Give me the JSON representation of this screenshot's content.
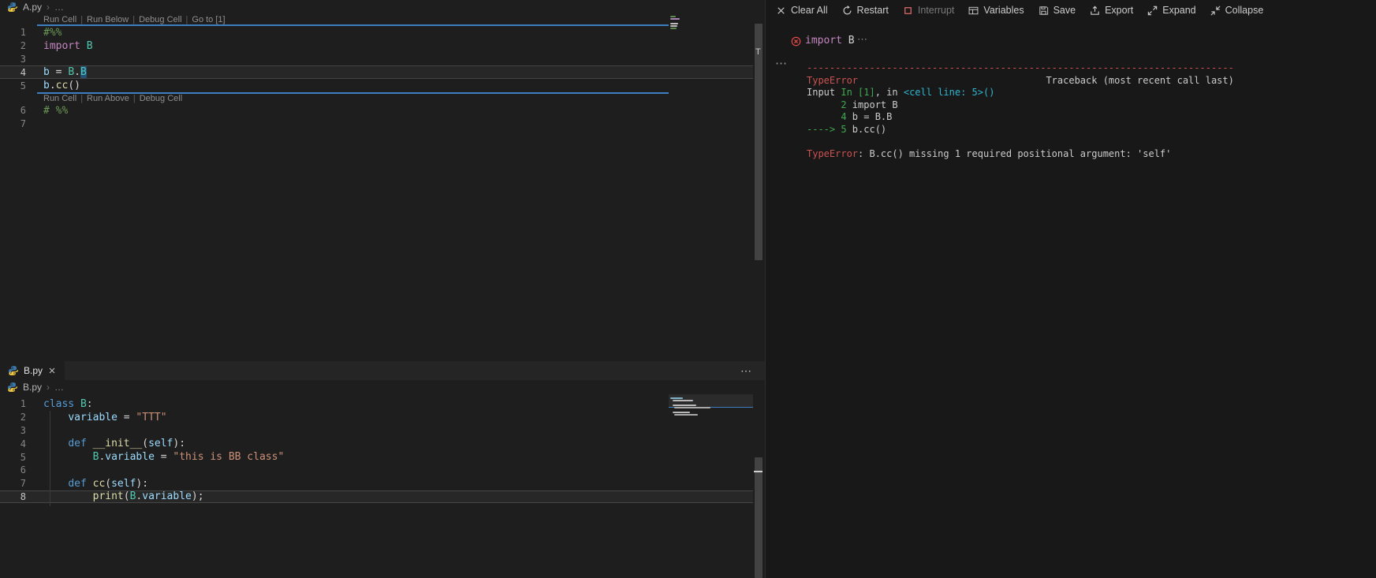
{
  "palette": {
    "comment": "#6A9955",
    "keyword": "#C586C0",
    "storage": "#569CD6",
    "cls": "#4EC9B0",
    "func": "#DCDCAA",
    "var": "#9CDCFE",
    "string": "#CE9178",
    "plain": "#D4D4D4",
    "red": "#CD5252",
    "green": "#3FA94F",
    "cyan": "#2FB4CE",
    "fg": "#CCCCCC",
    "dim": "#8A8A8A"
  },
  "breadcrumb_a": {
    "file": "A.py",
    "sep": "›",
    "more": "…"
  },
  "breadcrumb_b": {
    "file": "B.py",
    "sep": "›",
    "more": "…"
  },
  "editor_a": {
    "codelens1": [
      "Run Cell",
      "Run Below",
      "Debug Cell",
      "Go to [1]"
    ],
    "codelens2": [
      "Run Cell",
      "Run Above",
      "Debug Cell"
    ],
    "cell1_rows": [
      {
        "n": "1",
        "tokens": [
          [
            "#%%",
            "comment"
          ]
        ]
      },
      {
        "n": "2",
        "tokens": [
          [
            "import",
            "keyword"
          ],
          [
            " ",
            "plain"
          ],
          [
            "B",
            "cls"
          ]
        ]
      },
      {
        "n": "3",
        "tokens": []
      },
      {
        "n": "4",
        "active": true,
        "tokens": [
          [
            "b",
            "var"
          ],
          [
            " = ",
            "plain"
          ],
          [
            "B",
            "cls"
          ],
          [
            ".",
            "plain"
          ],
          [
            "B",
            "cls",
            "hl"
          ]
        ]
      },
      {
        "n": "5",
        "tokens": [
          [
            "b",
            "var"
          ],
          [
            ".",
            "plain"
          ],
          [
            "cc",
            "func"
          ],
          [
            "()",
            "plain"
          ]
        ]
      }
    ],
    "cell2_rows": [
      {
        "n": "6",
        "tokens": [
          [
            "# %%",
            "comment"
          ]
        ]
      },
      {
        "n": "7",
        "tokens": []
      }
    ],
    "scroll_mark": "T"
  },
  "tabbar": {
    "tab": "B.py",
    "more": "⋯"
  },
  "editor_b": {
    "rows": [
      {
        "n": "1",
        "tokens": [
          [
            "class",
            "storage"
          ],
          [
            " ",
            "plain"
          ],
          [
            "B",
            "cls"
          ],
          [
            ":",
            "plain"
          ]
        ]
      },
      {
        "n": "2",
        "tokens": [
          [
            "    ",
            "plain"
          ],
          [
            "variable",
            "var"
          ],
          [
            " = ",
            "plain"
          ],
          [
            "\"TTT\"",
            "string"
          ]
        ]
      },
      {
        "n": "3",
        "tokens": []
      },
      {
        "n": "4",
        "tokens": [
          [
            "    ",
            "plain"
          ],
          [
            "def",
            "storage"
          ],
          [
            " ",
            "plain"
          ],
          [
            "__init__",
            "func"
          ],
          [
            "(",
            "plain"
          ],
          [
            "self",
            "var"
          ],
          [
            "):",
            "plain"
          ]
        ]
      },
      {
        "n": "5",
        "tokens": [
          [
            "        ",
            "plain"
          ],
          [
            "B",
            "cls"
          ],
          [
            ".",
            "plain"
          ],
          [
            "variable",
            "var"
          ],
          [
            " = ",
            "plain"
          ],
          [
            "\"this is BB class\"",
            "string"
          ]
        ]
      },
      {
        "n": "6",
        "tokens": []
      },
      {
        "n": "7",
        "tokens": [
          [
            "    ",
            "plain"
          ],
          [
            "def",
            "storage"
          ],
          [
            " ",
            "plain"
          ],
          [
            "cc",
            "func"
          ],
          [
            "(",
            "plain"
          ],
          [
            "self",
            "var"
          ],
          [
            "):",
            "plain"
          ]
        ]
      },
      {
        "n": "8",
        "active": true,
        "tokens": [
          [
            "        ",
            "plain"
          ],
          [
            "print",
            "func"
          ],
          [
            "(",
            "plain"
          ],
          [
            "B",
            "cls"
          ],
          [
            ".",
            "plain"
          ],
          [
            "variable",
            "var"
          ],
          [
            ");",
            "plain"
          ]
        ]
      }
    ]
  },
  "toolbar": {
    "buttons": [
      {
        "id": "clear-all",
        "icon": "close",
        "label": "Clear All"
      },
      {
        "id": "restart",
        "icon": "restart",
        "label": "Restart"
      },
      {
        "id": "interrupt",
        "icon": "interrupt",
        "label": "Interrupt",
        "disabled": true
      },
      {
        "id": "variables",
        "icon": "variables",
        "label": "Variables"
      },
      {
        "id": "save",
        "icon": "save",
        "label": "Save"
      },
      {
        "id": "export",
        "icon": "export",
        "label": "Export"
      },
      {
        "id": "expand",
        "icon": "expand",
        "label": "Expand"
      },
      {
        "id": "collapse",
        "icon": "collapse",
        "label": "Collapse"
      }
    ]
  },
  "interactive": {
    "cell_code": [
      [
        "import",
        "keyword"
      ],
      [
        " B",
        "plain"
      ]
    ],
    "cell_more": "⋯",
    "gutter_more": "⋯",
    "output_lines": [
      [
        [
          "---------------------------------------------------------------------------",
          "red"
        ]
      ],
      [
        [
          "TypeError",
          "red"
        ],
        [
          "                                 Traceback (most recent call last)",
          "fg"
        ]
      ],
      [
        [
          "Input ",
          "fg"
        ],
        [
          "In [1]",
          "green"
        ],
        [
          ", in ",
          "fg"
        ],
        [
          "<cell line: 5>()",
          "cyan"
        ]
      ],
      [
        [
          "      2",
          "green"
        ],
        [
          " import B",
          "fg"
        ]
      ],
      [
        [
          "      4",
          "green"
        ],
        [
          " b = B.B",
          "fg"
        ]
      ],
      [
        [
          "----> 5",
          "green"
        ],
        [
          " b.cc()",
          "fg"
        ]
      ],
      [],
      [
        [
          "TypeError",
          "red"
        ],
        [
          ": B.cc() missing 1 required positional argument: 'self'",
          "fg"
        ]
      ]
    ]
  }
}
